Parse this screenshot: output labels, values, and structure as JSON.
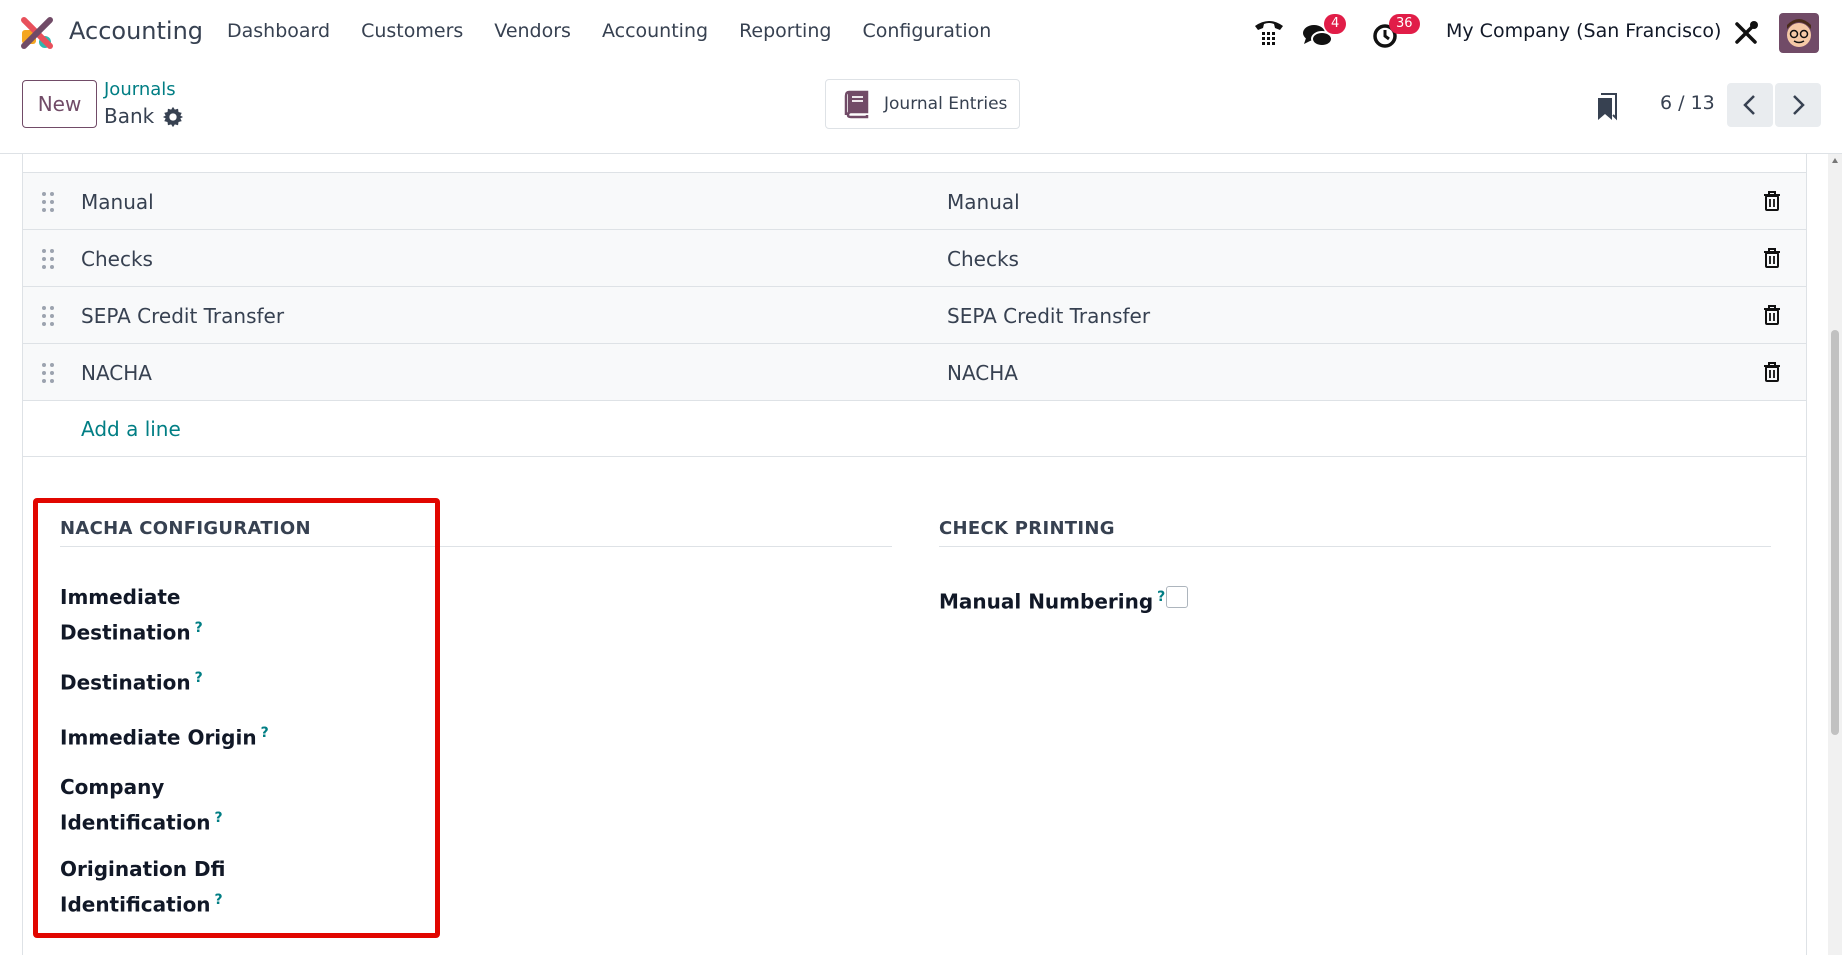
{
  "navbar": {
    "app_name": "Accounting",
    "menu": [
      "Dashboard",
      "Customers",
      "Vendors",
      "Accounting",
      "Reporting",
      "Configuration"
    ],
    "chat_badge": "4",
    "activity_badge": "36",
    "company": "My Company (San Francisco)",
    "badge_color": "#e11d48"
  },
  "control": {
    "new_label": "New",
    "breadcrumb_parent": "Journals",
    "breadcrumb_current": "Bank",
    "journal_entries_label": "Journal Entries",
    "pager": "6 / 13"
  },
  "payment_methods": {
    "rows": [
      {
        "name": "Manual",
        "label": "Manual"
      },
      {
        "name": "Checks",
        "label": "Checks"
      },
      {
        "name": "SEPA Credit Transfer",
        "label": "SEPA Credit Transfer"
      },
      {
        "name": "NACHA",
        "label": "NACHA"
      }
    ],
    "add_line": "Add a line"
  },
  "nacha": {
    "title": "NACHA CONFIGURATION",
    "fields": [
      [
        "Immediate",
        "Destination"
      ],
      [
        "Destination"
      ],
      [
        "Immediate Origin"
      ],
      [
        "Company",
        "Identification"
      ],
      [
        "Origination Dfi",
        "Identification"
      ]
    ],
    "help_mark": "?"
  },
  "check_printing": {
    "title": "CHECK PRINTING",
    "manual_numbering": "Manual Numbering",
    "help_mark": "?"
  },
  "colors": {
    "brand": "#714b67",
    "link": "#017e84",
    "highlight": "#e10600"
  }
}
